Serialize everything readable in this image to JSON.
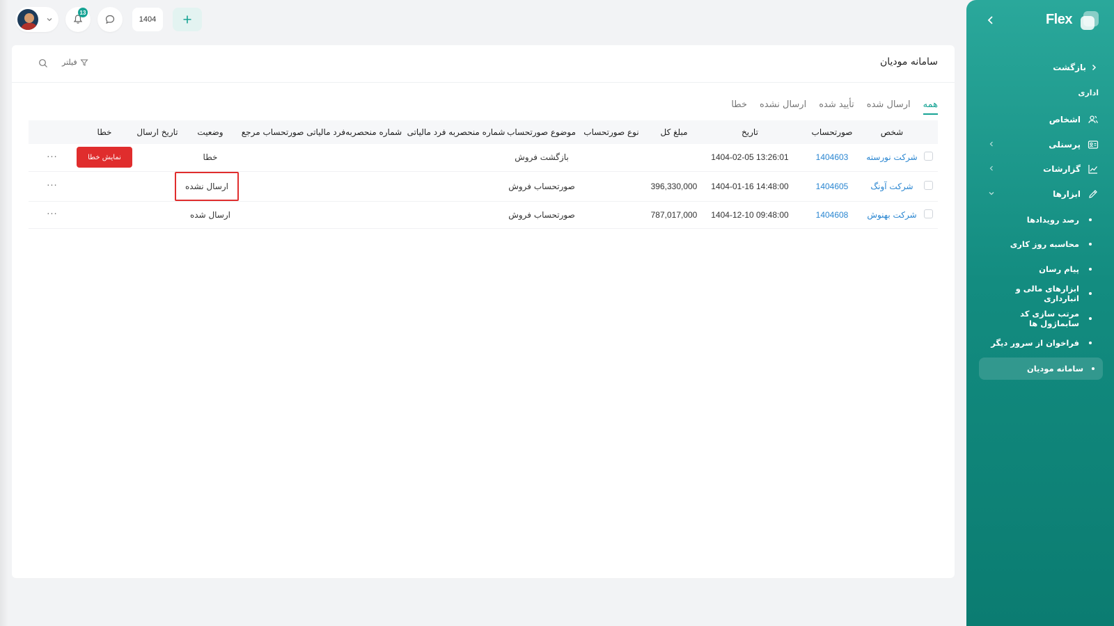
{
  "brand": {
    "name": "Flex"
  },
  "sidebar": {
    "back_label": "بازگشت",
    "section_label": "اداری",
    "items": [
      {
        "label": "اشخاص",
        "icon": "users-icon"
      },
      {
        "label": "پرسنلی",
        "icon": "id-card-icon"
      },
      {
        "label": "گزارشات",
        "icon": "chart-icon"
      },
      {
        "label": "ابزارها",
        "icon": "pencil-icon"
      }
    ],
    "sub_items": [
      {
        "label": "رصد رویدادها"
      },
      {
        "label": "محاسبه روز کاری"
      },
      {
        "label": "پیام رسان"
      },
      {
        "label": "ابزارهای مالی و انبارداری"
      },
      {
        "label": "مرتب سازی کد سابماژول ها"
      },
      {
        "label": "فراخوان از سرور دیگر"
      },
      {
        "label": "سامانه مودیان",
        "active": true
      }
    ]
  },
  "topbar": {
    "notifications_count": "13",
    "year": "1404"
  },
  "page": {
    "title": "سامانه مودیان",
    "filter_label": "فیلتر",
    "tabs": [
      {
        "label": "همه",
        "active": true
      },
      {
        "label": "ارسال شده"
      },
      {
        "label": "تأیید شده"
      },
      {
        "label": "ارسال نشده"
      },
      {
        "label": "خطا"
      }
    ]
  },
  "table": {
    "headers": {
      "person": "شخص",
      "invoice": "صورتحساب",
      "date": "تاریخ",
      "total": "مبلغ کل",
      "invoice_type": "نوع صورتحساب",
      "invoice_subject": "موضوع صورتحساب",
      "tax_id": "شماره منحصربه فرد مالیاتی",
      "ref_tax_id": "شماره منحصربه‌فرد مالیاتی صورتحساب مرجع",
      "status": "وضعیت",
      "send_date": "تاریخ ارسال",
      "error": "خطا"
    },
    "rows": [
      {
        "person": "شرکت نورسته",
        "invoice": "1404603",
        "date": "1404-02-05 13:26:01",
        "total": "",
        "invoice_type": "",
        "invoice_subject": "بازگشت فروش",
        "tax_id": "",
        "ref_tax_id": "",
        "status": "خطا",
        "send_date": "",
        "error_button": "نمایش خطا"
      },
      {
        "person": "شرکت آونگ",
        "invoice": "1404605",
        "date": "1404-01-16 14:48:00",
        "total": "396,330,000",
        "invoice_type": "",
        "invoice_subject": "صورتحساب فروش",
        "tax_id": "",
        "ref_tax_id": "",
        "status": "ارسال نشده",
        "send_date": "",
        "error_button": ""
      },
      {
        "person": "شرکت بهنوش",
        "invoice": "1404608",
        "date": "1404-12-10 09:48:00",
        "total": "787,017,000",
        "invoice_type": "",
        "invoice_subject": "صورتحساب فروش",
        "tax_id": "",
        "ref_tax_id": "",
        "status": "ارسال شده",
        "send_date": "",
        "error_button": ""
      }
    ],
    "more_label": "···"
  },
  "colors": {
    "accent": "#16a394",
    "sidebar_top": "#2aa89b",
    "sidebar_bottom": "#0b7c71",
    "error": "#e02d2d",
    "link": "#2a86d1"
  }
}
